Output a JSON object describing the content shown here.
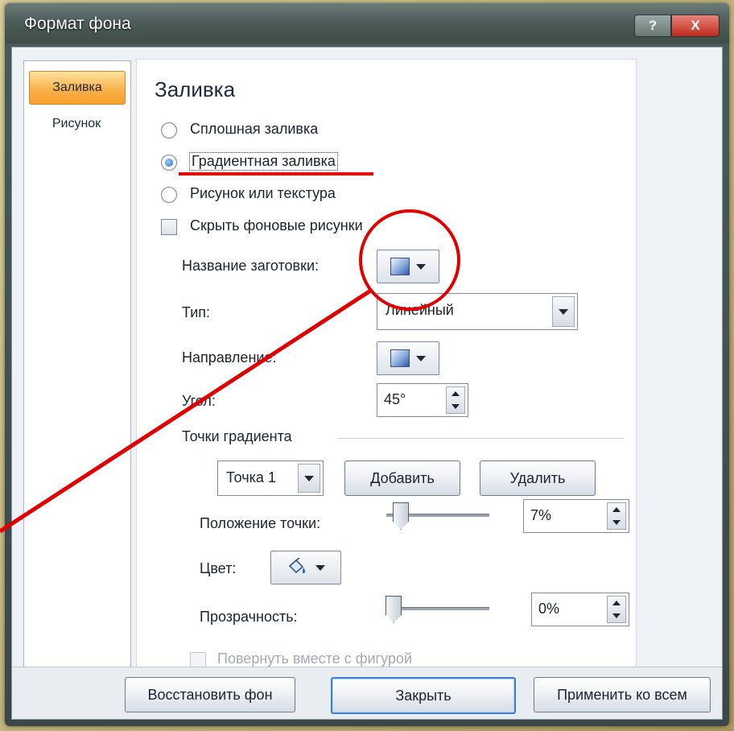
{
  "window": {
    "title": "Формат фона",
    "help_label": "?",
    "close_label": "X"
  },
  "sidebar": {
    "items": [
      {
        "label": "Заливка",
        "active": true
      },
      {
        "label": "Рисунок",
        "active": false
      }
    ]
  },
  "fill": {
    "heading": "Заливка",
    "options": [
      {
        "label": "Сплошная заливка",
        "checked": false
      },
      {
        "label": "Градиентная заливка",
        "checked": true
      },
      {
        "label": "Рисунок или текстура",
        "checked": false
      }
    ],
    "hide_background": {
      "label": "Скрыть фоновые рисунки",
      "checked": false
    },
    "preset_label": "Название заготовки:",
    "type_label": "Тип:",
    "type_value": "Линейный",
    "direction_label": "Направление:",
    "angle_label": "Угол:",
    "angle_value": "45°",
    "stops_group": "Точки градиента",
    "stop_select_value": "Точка 1",
    "add_button": "Добавить",
    "remove_button": "Удалить",
    "position_label": "Положение точки:",
    "position_value": "7%",
    "position_fraction": 0.07,
    "color_label": "Цвет:",
    "transparency_label": "Прозрачность:",
    "transparency_value": "0%",
    "transparency_fraction": 0.0,
    "rotate_with_shape": {
      "label": "Повернуть вместе с фигурой",
      "checked": false,
      "disabled": true
    }
  },
  "footer": {
    "reset_button": "Восстановить фон",
    "close_button": "Закрыть",
    "apply_all_button": "Применить ко всем"
  },
  "colors": {
    "annotation": "#e00000",
    "active_tab": "#f9b24a",
    "title_bar": "#4e5d5a",
    "default_button_border": "#3c7fd6"
  },
  "icons": {
    "preset": "gradient-swatch-icon",
    "direction": "gradient-swatch-icon",
    "color": "paint-bucket-icon"
  }
}
